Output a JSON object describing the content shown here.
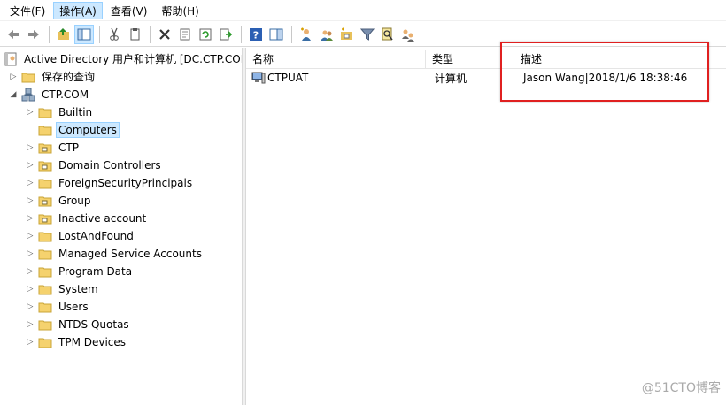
{
  "menu": [
    "文件(F)",
    "操作(A)",
    "查看(V)",
    "帮助(H)"
  ],
  "menu_active": 1,
  "toolbar_icons": [
    "back-arrow-icon",
    "forward-arrow-icon",
    "up-folder-icon",
    "show-hide-console-tree-icon",
    "cut-icon",
    "copy-icon",
    "delete-icon",
    "properties-icon",
    "refresh-icon",
    "export-list-icon",
    "help-icon",
    "action-pane-icon",
    "new-user-icon",
    "new-group-icon",
    "new-ou-icon",
    "filter-icon",
    "find-icon",
    "add-to-group-icon"
  ],
  "tree": {
    "root_label": "Active Directory 用户和计算机 [DC.CTP.COM]",
    "saved_queries": "保存的查询",
    "domain": "CTP.COM",
    "children": [
      {
        "label": "Builtin",
        "icon": "folder-icon"
      },
      {
        "label": "Computers",
        "icon": "folder-icon",
        "selected": true
      },
      {
        "label": "CTP",
        "icon": "ou-folder-icon"
      },
      {
        "label": "Domain Controllers",
        "icon": "ou-folder-icon"
      },
      {
        "label": "ForeignSecurityPrincipals",
        "icon": "folder-icon"
      },
      {
        "label": "Group",
        "icon": "ou-folder-icon"
      },
      {
        "label": "Inactive account",
        "icon": "ou-folder-icon"
      },
      {
        "label": "LostAndFound",
        "icon": "folder-icon"
      },
      {
        "label": "Managed Service Accounts",
        "icon": "folder-icon"
      },
      {
        "label": "Program Data",
        "icon": "folder-icon"
      },
      {
        "label": "System",
        "icon": "folder-icon"
      },
      {
        "label": "Users",
        "icon": "folder-icon"
      },
      {
        "label": "NTDS Quotas",
        "icon": "folder-icon"
      },
      {
        "label": "TPM Devices",
        "icon": "folder-icon"
      }
    ]
  },
  "list": {
    "columns": [
      "名称",
      "类型",
      "描述"
    ],
    "rows": [
      {
        "name": "CTPUAT",
        "type": "计算机",
        "description": "Jason Wang|2018/1/6 18:38:46",
        "icon": "computer-icon"
      }
    ]
  },
  "watermark": "@51CTO博客",
  "colors": {
    "selection": "#cce8ff",
    "highlight_box": "#e02020",
    "folder": "#f5d26e"
  }
}
